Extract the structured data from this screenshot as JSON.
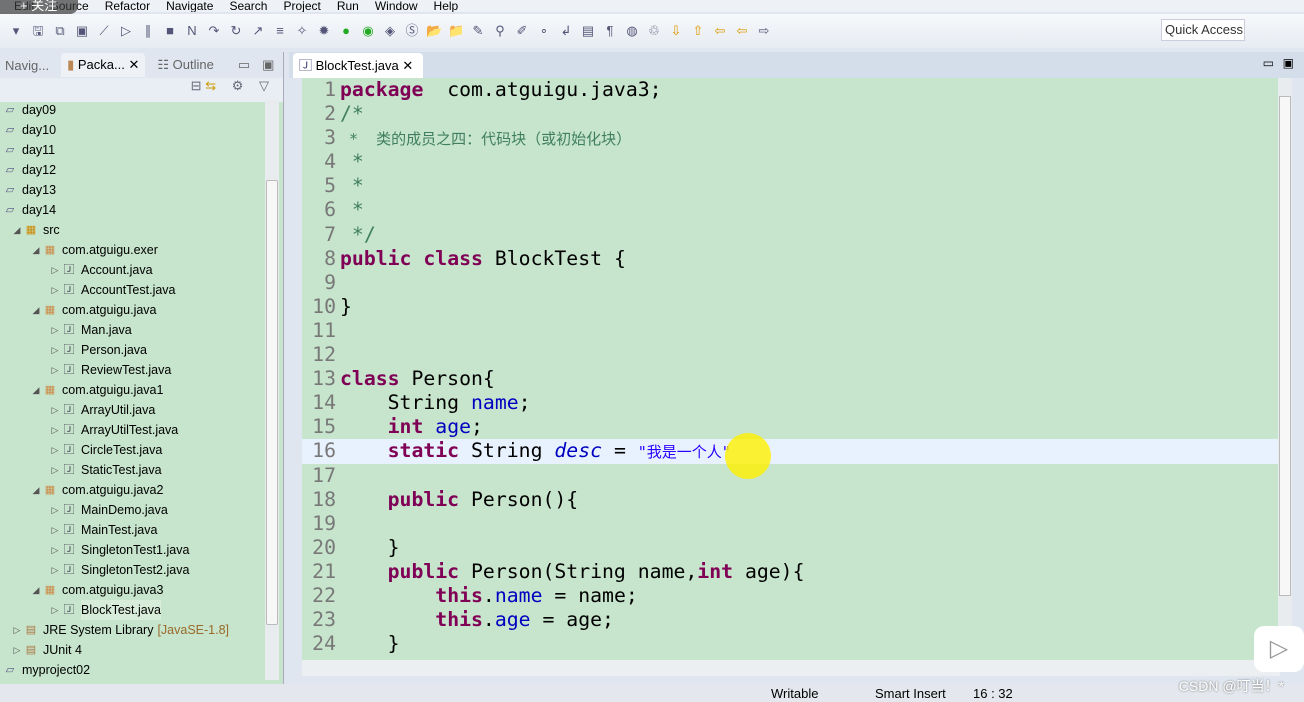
{
  "menu": [
    "Edit",
    "Source",
    "Refactor",
    "Navigate",
    "Search",
    "Project",
    "Run",
    "Window",
    "Help"
  ],
  "overlay_follow": "+ 关注",
  "quick_access": "Quick Access",
  "left_tabs": [
    "Navig...",
    "Packa...",
    "Outline"
  ],
  "tree": [
    {
      "label": "day09",
      "level": 0,
      "icon": "project-icon",
      "tw": ""
    },
    {
      "label": "day10",
      "level": 0,
      "icon": "project-icon",
      "tw": ""
    },
    {
      "label": "day11",
      "level": 0,
      "icon": "project-icon",
      "tw": ""
    },
    {
      "label": "day12",
      "level": 0,
      "icon": "project-icon",
      "tw": ""
    },
    {
      "label": "day13",
      "level": 0,
      "icon": "project-icon",
      "tw": ""
    },
    {
      "label": "day14",
      "level": 0,
      "icon": "project-icon",
      "tw": ""
    },
    {
      "label": "src",
      "level": 1,
      "icon": "source-folder-icon",
      "tw": "◢"
    },
    {
      "label": "com.atguigu.exer",
      "level": 2,
      "icon": "package-icon",
      "tw": "◢"
    },
    {
      "label": "Account.java",
      "level": 3,
      "icon": "java-file-icon",
      "tw": "▷"
    },
    {
      "label": "AccountTest.java",
      "level": 3,
      "icon": "java-file-icon",
      "tw": "▷"
    },
    {
      "label": "com.atguigu.java",
      "level": 2,
      "icon": "package-icon",
      "tw": "◢"
    },
    {
      "label": "Man.java",
      "level": 3,
      "icon": "java-file-icon",
      "tw": "▷"
    },
    {
      "label": "Person.java",
      "level": 3,
      "icon": "java-file-icon",
      "tw": "▷"
    },
    {
      "label": "ReviewTest.java",
      "level": 3,
      "icon": "java-file-icon",
      "tw": "▷"
    },
    {
      "label": "com.atguigu.java1",
      "level": 2,
      "icon": "package-icon",
      "tw": "◢"
    },
    {
      "label": "ArrayUtil.java",
      "level": 3,
      "icon": "java-file-icon",
      "tw": "▷"
    },
    {
      "label": "ArrayUtilTest.java",
      "level": 3,
      "icon": "java-file-icon",
      "tw": "▷"
    },
    {
      "label": "CircleTest.java",
      "level": 3,
      "icon": "java-file-icon",
      "tw": "▷"
    },
    {
      "label": "StaticTest.java",
      "level": 3,
      "icon": "java-file-icon",
      "tw": "▷"
    },
    {
      "label": "com.atguigu.java2",
      "level": 2,
      "icon": "package-icon",
      "tw": "◢"
    },
    {
      "label": "MainDemo.java",
      "level": 3,
      "icon": "java-file-icon",
      "tw": "▷"
    },
    {
      "label": "MainTest.java",
      "level": 3,
      "icon": "java-file-icon",
      "tw": "▷"
    },
    {
      "label": "SingletonTest1.java",
      "level": 3,
      "icon": "java-file-icon",
      "tw": "▷"
    },
    {
      "label": "SingletonTest2.java",
      "level": 3,
      "icon": "java-file-icon",
      "tw": "▷"
    },
    {
      "label": "com.atguigu.java3",
      "level": 2,
      "icon": "package-icon",
      "tw": "◢"
    },
    {
      "label": "BlockTest.java",
      "level": 3,
      "icon": "java-file-icon",
      "tw": "▷"
    },
    {
      "label": "JRE System Library",
      "extra": "[JavaSE-1.8]",
      "level": 1,
      "icon": "library-icon",
      "tw": "▷"
    },
    {
      "label": "JUnit 4",
      "level": 1,
      "icon": "library-icon",
      "tw": "▷"
    },
    {
      "label": "myproject02",
      "level": 0,
      "icon": "project-icon",
      "tw": ""
    }
  ],
  "editor_tab": "BlockTest.java",
  "code": [
    [
      [
        "kw",
        "package"
      ],
      [
        "",
        "  com.atguigu.java3;"
      ]
    ],
    [
      [
        "cm",
        "/*"
      ]
    ],
    [
      [
        "cm",
        " *  类的成员之四：代码块（或初始化块）"
      ]
    ],
    [
      [
        "cm",
        " *"
      ]
    ],
    [
      [
        "cm",
        " *"
      ]
    ],
    [
      [
        "cm",
        " *"
      ]
    ],
    [
      [
        "cm",
        " */"
      ]
    ],
    [
      [
        "kw",
        "public"
      ],
      [
        "",
        " "
      ],
      [
        "kw",
        "class"
      ],
      [
        "",
        " BlockTest {"
      ]
    ],
    [],
    [
      [
        "",
        "}"
      ]
    ],
    [],
    [],
    [
      [
        "kw",
        "class"
      ],
      [
        "",
        " Person{"
      ]
    ],
    [
      [
        "",
        "    String "
      ],
      [
        "fd",
        "name"
      ],
      [
        "",
        ";"
      ]
    ],
    [
      [
        "",
        "    "
      ],
      [
        "kw",
        "int"
      ],
      [
        "",
        " "
      ],
      [
        "fd",
        "age"
      ],
      [
        "",
        ";"
      ]
    ],
    [
      [
        "",
        "    "
      ],
      [
        "kw",
        "static"
      ],
      [
        "",
        " String "
      ],
      [
        "fd it",
        "desc"
      ],
      [
        "",
        " = "
      ],
      [
        "st",
        "\"我是一个人\""
      ]
    ],
    [],
    [
      [
        "",
        "    "
      ],
      [
        "kw",
        "public"
      ],
      [
        "",
        " Person(){"
      ]
    ],
    [],
    [
      [
        "",
        "    }"
      ]
    ],
    [
      [
        "",
        "    "
      ],
      [
        "kw",
        "public"
      ],
      [
        "",
        " Person(String name,"
      ],
      [
        "kw",
        "int"
      ],
      [
        "",
        " age){"
      ]
    ],
    [
      [
        "",
        "        "
      ],
      [
        "kw",
        "this"
      ],
      [
        "",
        "."
      ],
      [
        "fd",
        "name"
      ],
      [
        "",
        " = name;"
      ]
    ],
    [
      [
        "",
        "        "
      ],
      [
        "kw",
        "this"
      ],
      [
        "",
        "."
      ],
      [
        "fd",
        "age"
      ],
      [
        "",
        " = age;"
      ]
    ],
    [
      [
        "",
        "    }"
      ]
    ]
  ],
  "current_line": 16,
  "status": {
    "mode": "Writable",
    "insert": "Smart Insert",
    "position": "16 : 32"
  },
  "watermark": "CSDN @叮当！*",
  "colors": {
    "keyword": "#7f0055",
    "field": "#0000c0",
    "string": "#2a00ff",
    "comment": "#3f7f5f",
    "editor_bg": "#c7e4cc"
  }
}
